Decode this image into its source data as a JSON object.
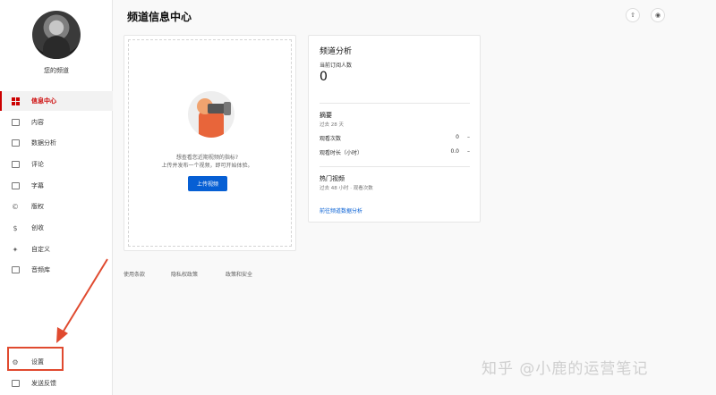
{
  "sidebar": {
    "channel_label": "您的频道",
    "items": [
      {
        "label": "信息中心",
        "icon": "dashboard-icon",
        "active": true
      },
      {
        "label": "内容",
        "icon": "video-icon"
      },
      {
        "label": "数据分析",
        "icon": "analytics-icon"
      },
      {
        "label": "评论",
        "icon": "comment-icon"
      },
      {
        "label": "字幕",
        "icon": "subtitles-icon"
      },
      {
        "label": "版权",
        "icon": "copyright-icon"
      },
      {
        "label": "创收",
        "icon": "dollar-icon"
      },
      {
        "label": "自定义",
        "icon": "magic-wand-icon"
      },
      {
        "label": "音频库",
        "icon": "audio-library-icon"
      }
    ],
    "bottom": [
      {
        "label": "设置",
        "icon": "gear-icon"
      },
      {
        "label": "发送反馈",
        "icon": "feedback-icon"
      }
    ]
  },
  "header": {
    "title": "频道信息中心"
  },
  "upload_card": {
    "line1": "想查看您近期视频的指标?",
    "line2": "上传并发布一个视频，即可开始体验。",
    "button": "上传视频"
  },
  "analytics_card": {
    "title": "频道分析",
    "subscribers_label": "当前订阅人数",
    "subscribers_value": "0",
    "summary_title": "摘要",
    "summary_period": "过去 28 天",
    "views_label": "观看次数",
    "views_value": "0",
    "views_delta": "–",
    "watch_time_label": "观看时长（小时）",
    "watch_time_value": "0.0",
    "watch_time_delta": "–",
    "top_videos_title": "热门视频",
    "top_videos_sub": "过去 48 小时 · 观看次数",
    "link": "前往频道数据分析"
  },
  "footer": {
    "links": [
      "使用条款",
      "隐私权政策",
      "政策和安全"
    ]
  },
  "watermark": "知乎 @小鹿的运营笔记",
  "colors": {
    "accent_red": "#cc0000",
    "link_blue": "#065fd4",
    "annotation": "#e04a2f"
  }
}
